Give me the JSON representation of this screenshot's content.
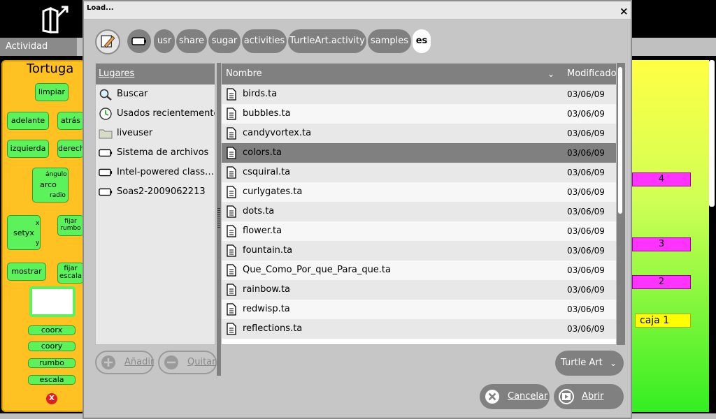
{
  "background": {
    "activity_tab": "Actividad",
    "palette_title": "Tortuga",
    "blocks": [
      "limpiar",
      "adelante",
      "atrás",
      "izquierda",
      "derecha",
      "ángulo",
      "arco",
      "radio",
      "setyx",
      "x",
      "y",
      "fijar rumbo",
      "mostrar",
      "fijar escala",
      "coorx",
      "coory",
      "rumbo",
      "escala",
      "X"
    ],
    "canvas_boxes": [
      "4",
      "3",
      "2"
    ],
    "caja_label": "caja 1"
  },
  "dialog": {
    "title": "Load...",
    "close_glyph": "×",
    "breadcrumbs": [
      "usr",
      "share",
      "sugar",
      "activities",
      "TurtleArt.activity",
      "samples",
      "es"
    ],
    "places_header": "Lugares",
    "places": [
      {
        "label": "Buscar",
        "icon": "search-icon"
      },
      {
        "label": "Usados recientemente",
        "icon": "recent-icon"
      },
      {
        "label": "liveuser",
        "icon": "folder-icon"
      },
      {
        "label": "Sistema de archivos",
        "icon": "drive-icon"
      },
      {
        "label": "Intel-powered class…",
        "icon": "drive-icon"
      },
      {
        "label": "Soas2-2009062213",
        "icon": "drive-icon"
      }
    ],
    "files_header": {
      "name": "Nombre",
      "modified": "Modificado",
      "sort_glyph": "⌄"
    },
    "files": [
      {
        "name": "birds.ta",
        "modified": "03/06/09"
      },
      {
        "name": "bubbles.ta",
        "modified": "03/06/09"
      },
      {
        "name": "candyvortex.ta",
        "modified": "03/06/09"
      },
      {
        "name": "colors.ta",
        "modified": "03/06/09"
      },
      {
        "name": "csquiral.ta",
        "modified": "03/06/09"
      },
      {
        "name": "curlygates.ta",
        "modified": "03/06/09"
      },
      {
        "name": "dots.ta",
        "modified": "03/06/09"
      },
      {
        "name": "flower.ta",
        "modified": "03/06/09"
      },
      {
        "name": "fountain.ta",
        "modified": "03/06/09"
      },
      {
        "name": "Que_Como_Por_que_Para_que.ta",
        "modified": "03/06/09"
      },
      {
        "name": "rainbow.ta",
        "modified": "03/06/09"
      },
      {
        "name": "redwisp.ta",
        "modified": "03/06/09"
      },
      {
        "name": "reflections.ta",
        "modified": "03/06/09"
      }
    ],
    "selected_file": "colors.ta",
    "add_label": "Añadir",
    "remove_label": "Quitar",
    "filter_label": "Turtle Art",
    "cancel_label": "Cancelar",
    "open_label": "Abrir"
  }
}
